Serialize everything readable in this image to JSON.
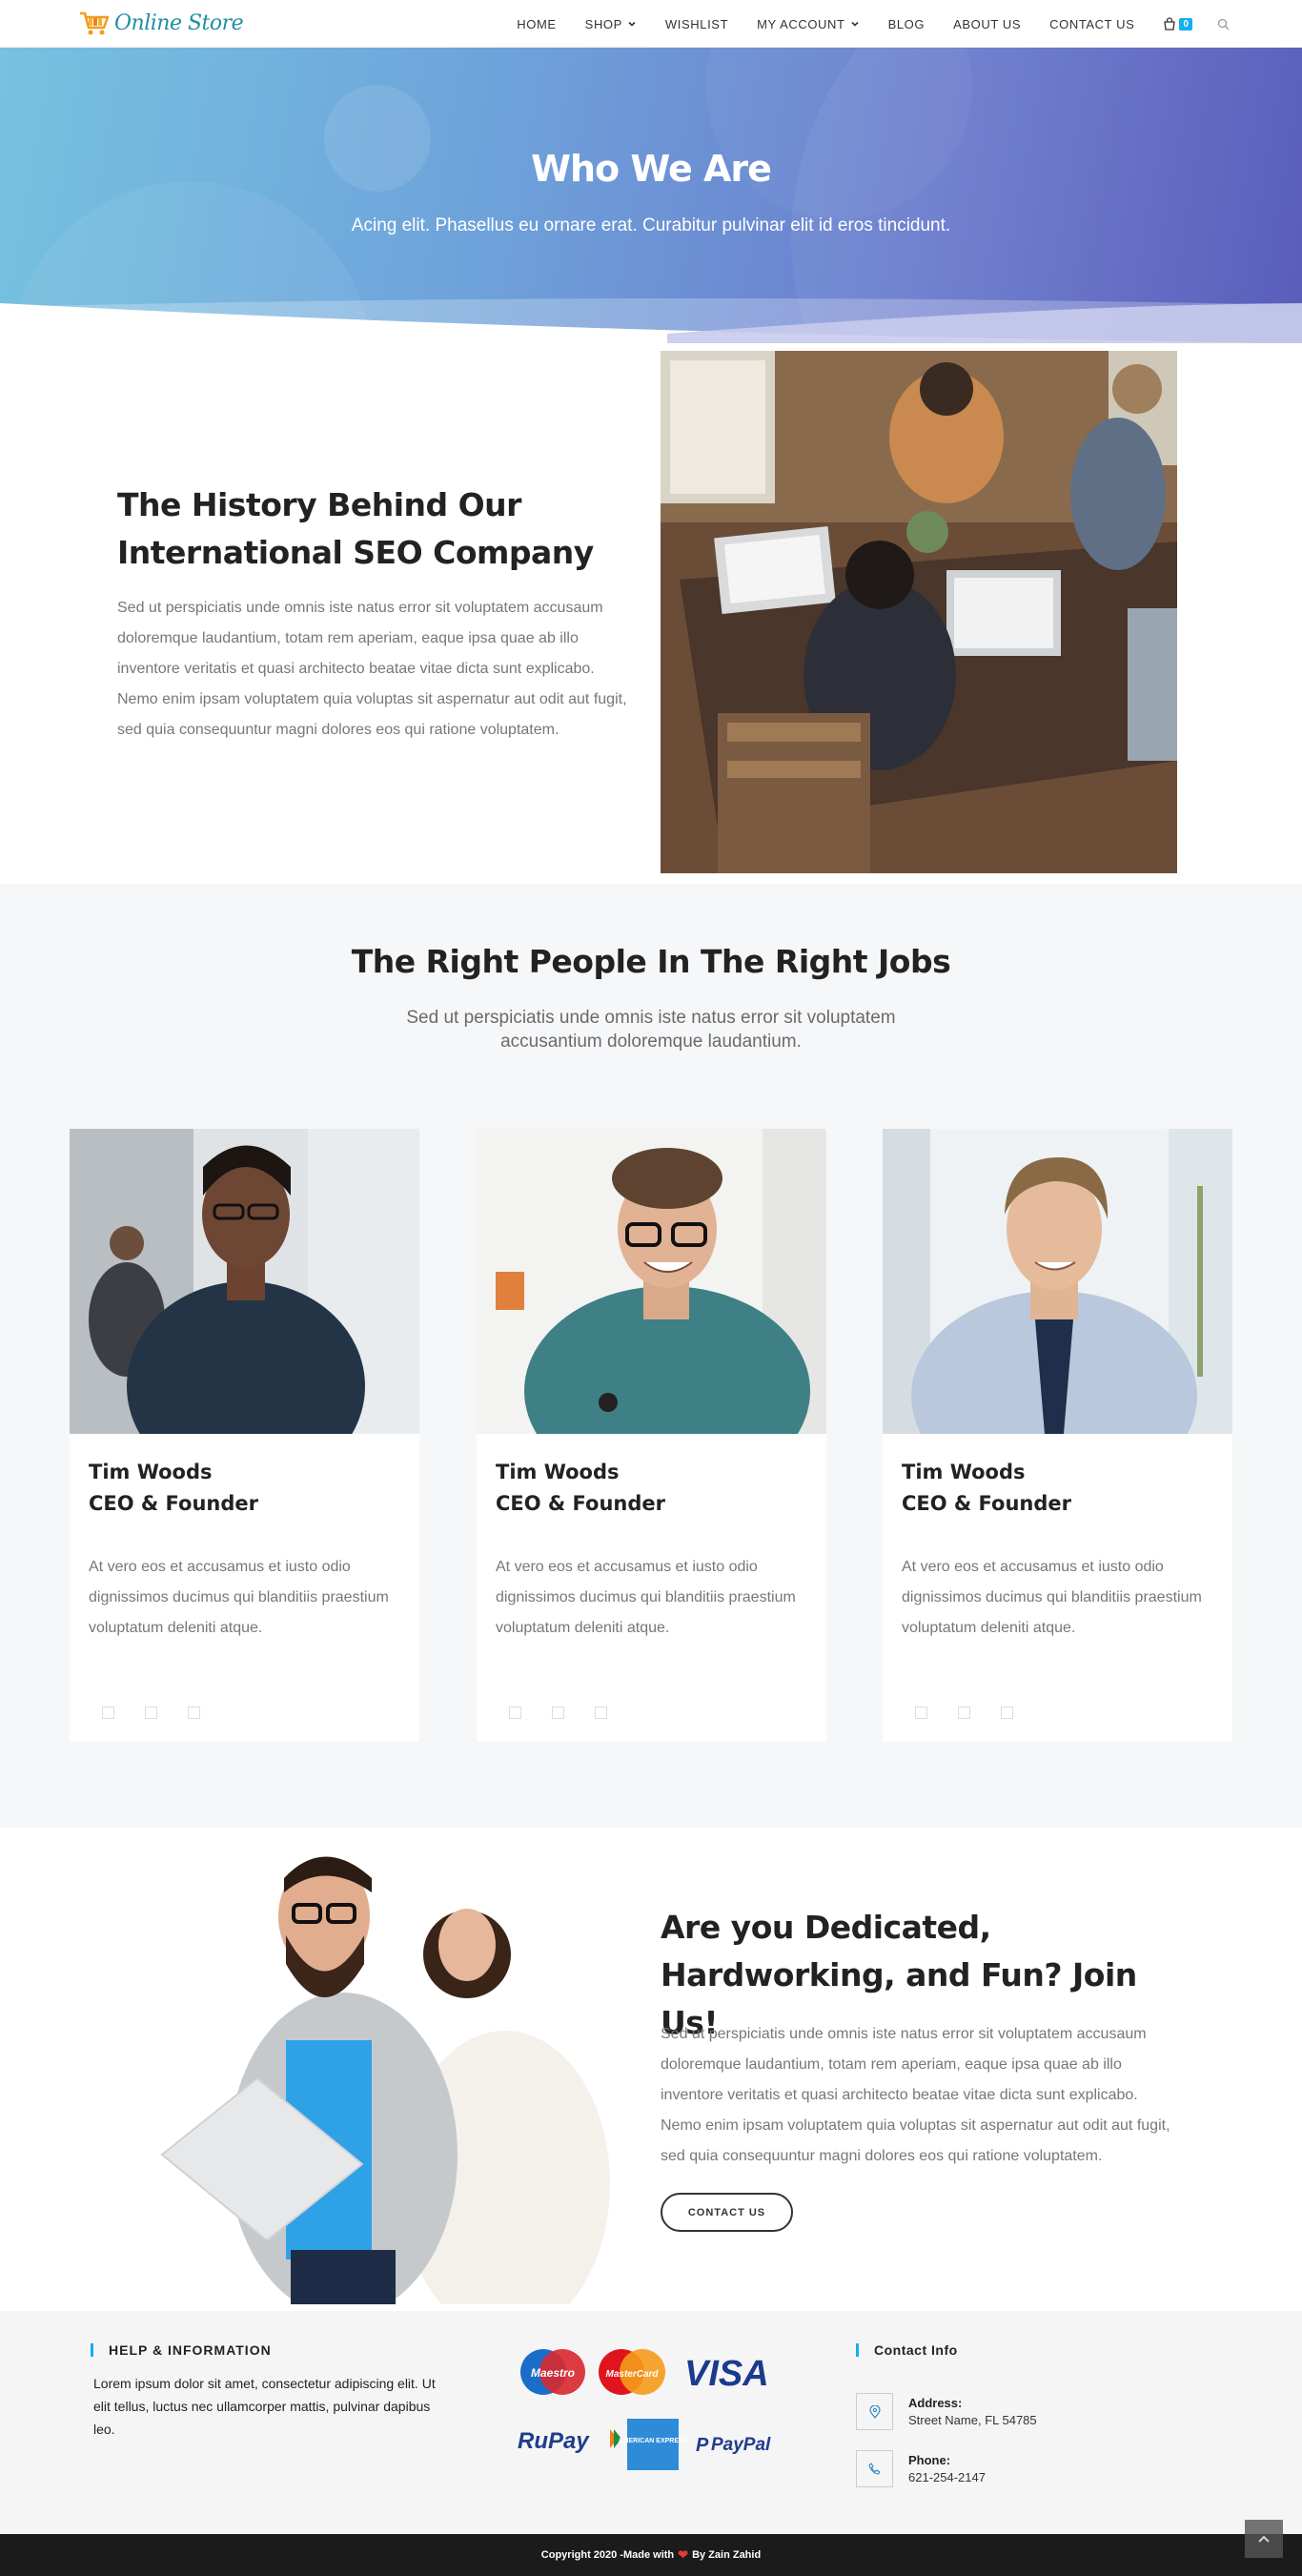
{
  "header": {
    "logo_text": "Online Store",
    "nav": [
      {
        "label": "HOME"
      },
      {
        "label": "SHOP"
      },
      {
        "label": "WISHLIST"
      },
      {
        "label": "MY ACCOUNT"
      },
      {
        "label": "BLOG"
      },
      {
        "label": "ABOUT US"
      },
      {
        "label": "CONTACT US"
      }
    ],
    "cart_count": "0"
  },
  "hero": {
    "title": "Who We Are",
    "subtitle": "Acing elit. Phasellus eu ornare erat. Curabitur pulvinar elit id eros tincidunt."
  },
  "history": {
    "title": "The History Behind Our International SEO Company",
    "text": "Sed ut perspiciatis unde omnis iste natus error sit voluptatem accusaum doloremque laudantium, totam rem aperiam, eaque ipsa quae ab illo inventore veritatis et quasi architecto beatae vitae dicta sunt explicabo. Nemo enim ipsam voluptatem quia voluptas sit aspernatur aut odit aut fugit, sed quia consequuntur magni dolores eos qui ratione voluptatem."
  },
  "team": {
    "title": "The Right People In The Right Jobs",
    "subtitle": "Sed ut perspiciatis unde omnis iste natus error sit voluptatem accusantium doloremque laudantium.",
    "members": [
      {
        "name": "Tim Woods",
        "role": "CEO & Founder",
        "text": "At vero eos et accusamus et iusto odio dignissimos ducimus qui blanditiis praestium voluptatum deleniti atque."
      },
      {
        "name": "Tim Woods",
        "role": "CEO & Founder",
        "text": "At vero eos et accusamus et iusto odio dignissimos ducimus qui blanditiis praestium voluptatum deleniti atque."
      },
      {
        "name": "Tim Woods",
        "role": "CEO & Founder",
        "text": "At vero eos et accusamus et iusto odio dignissimos ducimus qui blanditiis praestium voluptatum deleniti atque."
      }
    ]
  },
  "join": {
    "title": "Are you Dedicated, Hardworking, and Fun? Join Us!",
    "text": "Sed ut perspiciatis unde omnis iste natus error sit voluptatem accusaum doloremque laudantium, totam rem aperiam, eaque ipsa quae ab illo inventore veritatis et quasi architecto beatae vitae dicta sunt explicabo. Nemo enim ipsam voluptatem quia voluptas sit aspernatur aut odit aut fugit, sed quia consequuntur magni dolores eos qui ratione voluptatem.",
    "button": "CONTACT US"
  },
  "footer": {
    "help_title": "HELP & INFORMATION",
    "help_text": "Lorem ipsum dolor sit amet, consectetur adipiscing elit. Ut elit tellus, luctus nec ullamcorper mattis, pulvinar dapibus leo.",
    "payment_logos": [
      "Maestro",
      "MasterCard",
      "VISA",
      "RuPay",
      "AMERICAN EXPRESS",
      "PayPal"
    ],
    "contact_title": "Contact Info",
    "address_label": "Address:",
    "address_value": "Street Name, FL 54785",
    "phone_label": "Phone:",
    "phone_value": "621-254-2147"
  },
  "copyright": {
    "before": "Copyright 2020 -Made with",
    "heart": "❤",
    "after": "By Zain Zahid"
  },
  "colors": {
    "accent": "#13aff0",
    "hero_start": "#76c2e0",
    "hero_end": "#5055b7"
  }
}
